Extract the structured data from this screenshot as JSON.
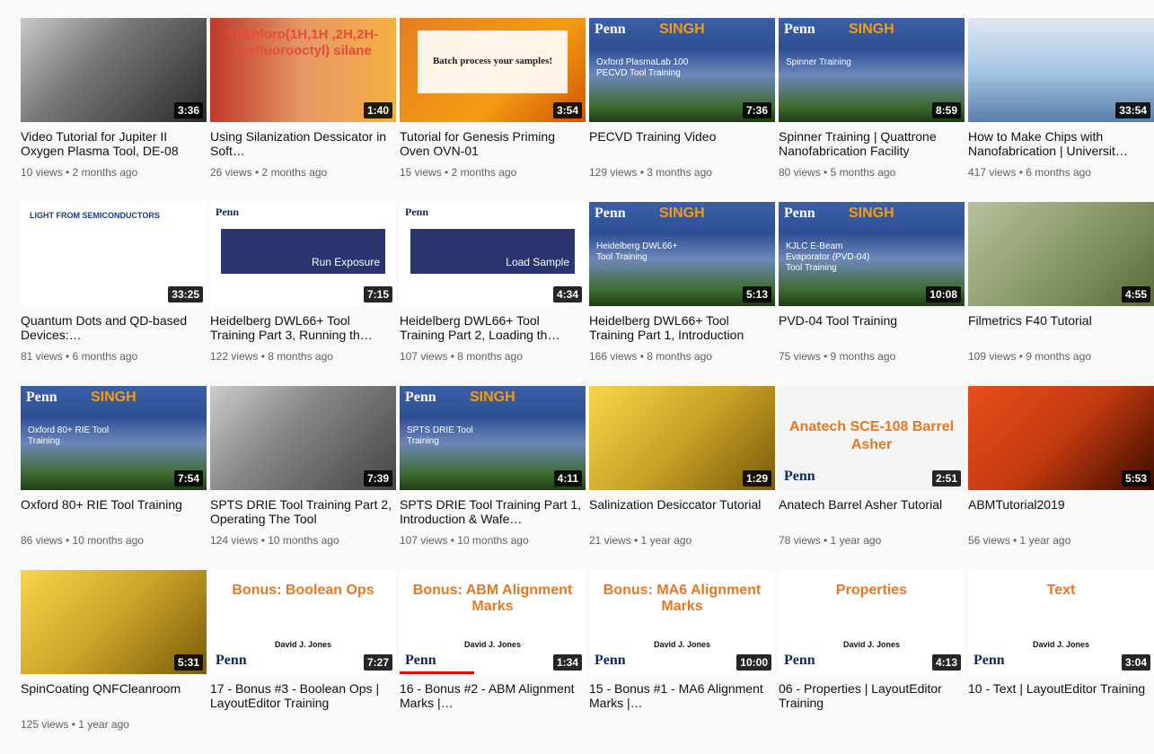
{
  "videos": [
    {
      "title": "Video Tutorial for Jupiter II Oxygen Plasma Tool, DE-08",
      "meta": "10 views • 2 months ago",
      "duration": "3:36",
      "thumb": "dark"
    },
    {
      "title": "Using Silanization Dessicator in Soft…",
      "meta": "26 views • 2 months ago",
      "duration": "1:40",
      "thumb": "red",
      "overlay": "Trichloro(1H,1H ,2H,2H- perfluorooctyl) silane"
    },
    {
      "title": "Tutorial for Genesis Priming Oven OVN-01",
      "meta": "15 views • 2 months ago",
      "duration": "3:54",
      "thumb": "orange",
      "overlay": "Batch process your samples!"
    },
    {
      "title": "PECVD Training Video",
      "meta": "129 views • 3 months ago",
      "duration": "7:36",
      "thumb": "penn",
      "caption": "Oxford PlasmaLab 100 PECVD Tool Training"
    },
    {
      "title": "Spinner Training | Quattrone Nanofabrication Facility",
      "meta": "80 views • 5 months ago",
      "duration": "8:59",
      "thumb": "penn",
      "caption": "Spinner Training"
    },
    {
      "title": "How to Make Chips with Nanofabrication | Universit…",
      "meta": "417 views • 6 months ago",
      "duration": "33:54",
      "thumb": "lab"
    },
    {
      "title": "Quantum Dots and QD-based Devices:…",
      "meta": "81 views • 6 months ago",
      "duration": "33:25",
      "thumb": "slide",
      "qd": "LIGHT FROM SEMICONDUCTORS"
    },
    {
      "title": "Heidelberg DWL66+ Tool Training Part 3, Running th…",
      "meta": "122 views • 8 months ago",
      "duration": "7:15",
      "thumb": "slide",
      "band": "Run Exposure"
    },
    {
      "title": "Heidelberg DWL66+ Tool Training Part 2, Loading th…",
      "meta": "107 views • 8 months ago",
      "duration": "4:34",
      "thumb": "slide",
      "band": "Load Sample"
    },
    {
      "title": "Heidelberg DWL66+ Tool Training Part 1, Introduction",
      "meta": "166 views • 8 months ago",
      "duration": "5:13",
      "thumb": "penn",
      "caption": "Heidelberg DWL66+ Tool Training"
    },
    {
      "title": "PVD-04 Tool Training",
      "meta": "75 views • 9 months ago",
      "duration": "10:08",
      "thumb": "penn",
      "caption": "KJLC E-Beam Evaporator (PVD-04) Tool Training"
    },
    {
      "title": "Filmetrics F40 Tutorial",
      "meta": "109 views • 9 months ago",
      "duration": "4:55",
      "thumb": "map"
    },
    {
      "title": "Oxford 80+ RIE Tool Training",
      "meta": "86 views • 10 months ago",
      "duration": "7:54",
      "thumb": "penn",
      "caption": "Oxford 80+ RIE Tool Training"
    },
    {
      "title": "SPTS DRIE Tool Training Part 2, Operating The Tool",
      "meta": "124 views • 10 months ago",
      "duration": "7:39",
      "thumb": "glove"
    },
    {
      "title": "SPTS DRIE Tool Training Part 1, Introduction & Wafe…",
      "meta": "107 views • 10 months ago",
      "duration": "4:11",
      "thumb": "penn",
      "caption": "SPTS DRIE Tool Training"
    },
    {
      "title": "Salinization Desiccator Tutorial",
      "meta": "21 views • 1 year ago",
      "duration": "1:29",
      "thumb": "yellow"
    },
    {
      "title": "Anatech Barrel Asher Tutorial",
      "meta": "78 views • 1 year ago",
      "duration": "2:51",
      "thumb": "white",
      "asher": "Anatech SCE-108 Barrel Asher"
    },
    {
      "title": "ABMTutorial2019",
      "meta": "56 views • 1 year ago",
      "duration": "5:53",
      "thumb": "orange2"
    },
    {
      "title": "SpinCoating QNFCleanroom",
      "meta": "125 views • 1 year ago",
      "duration": "5:31",
      "thumb": "yellow"
    },
    {
      "title": "17 - Bonus #3 - Boolean Ops | LayoutEditor Training",
      "meta": "",
      "duration": "7:27",
      "thumb": "slide",
      "slide": "Bonus: Boolean Ops"
    },
    {
      "title": "16 - Bonus #2 - ABM Alignment Marks |…",
      "meta": "",
      "duration": "1:34",
      "thumb": "slide",
      "slide": "Bonus: ABM Alignment Marks",
      "progress": 0.4
    },
    {
      "title": "15 - Bonus #1 - MA6 Alignment Marks |…",
      "meta": "",
      "duration": "10:00",
      "thumb": "slide",
      "slide": "Bonus: MA6 Alignment Marks"
    },
    {
      "title": "06 - Properties | LayoutEditor Training",
      "meta": "",
      "duration": "4:13",
      "thumb": "slide",
      "slide": "Properties"
    },
    {
      "title": "10 - Text | LayoutEditor Training",
      "meta": "",
      "duration": "3:04",
      "thumb": "slide",
      "slide": "Text"
    }
  ],
  "logos": {
    "penn": "Penn",
    "singh": "SINGH"
  },
  "author": "David J. Jones"
}
